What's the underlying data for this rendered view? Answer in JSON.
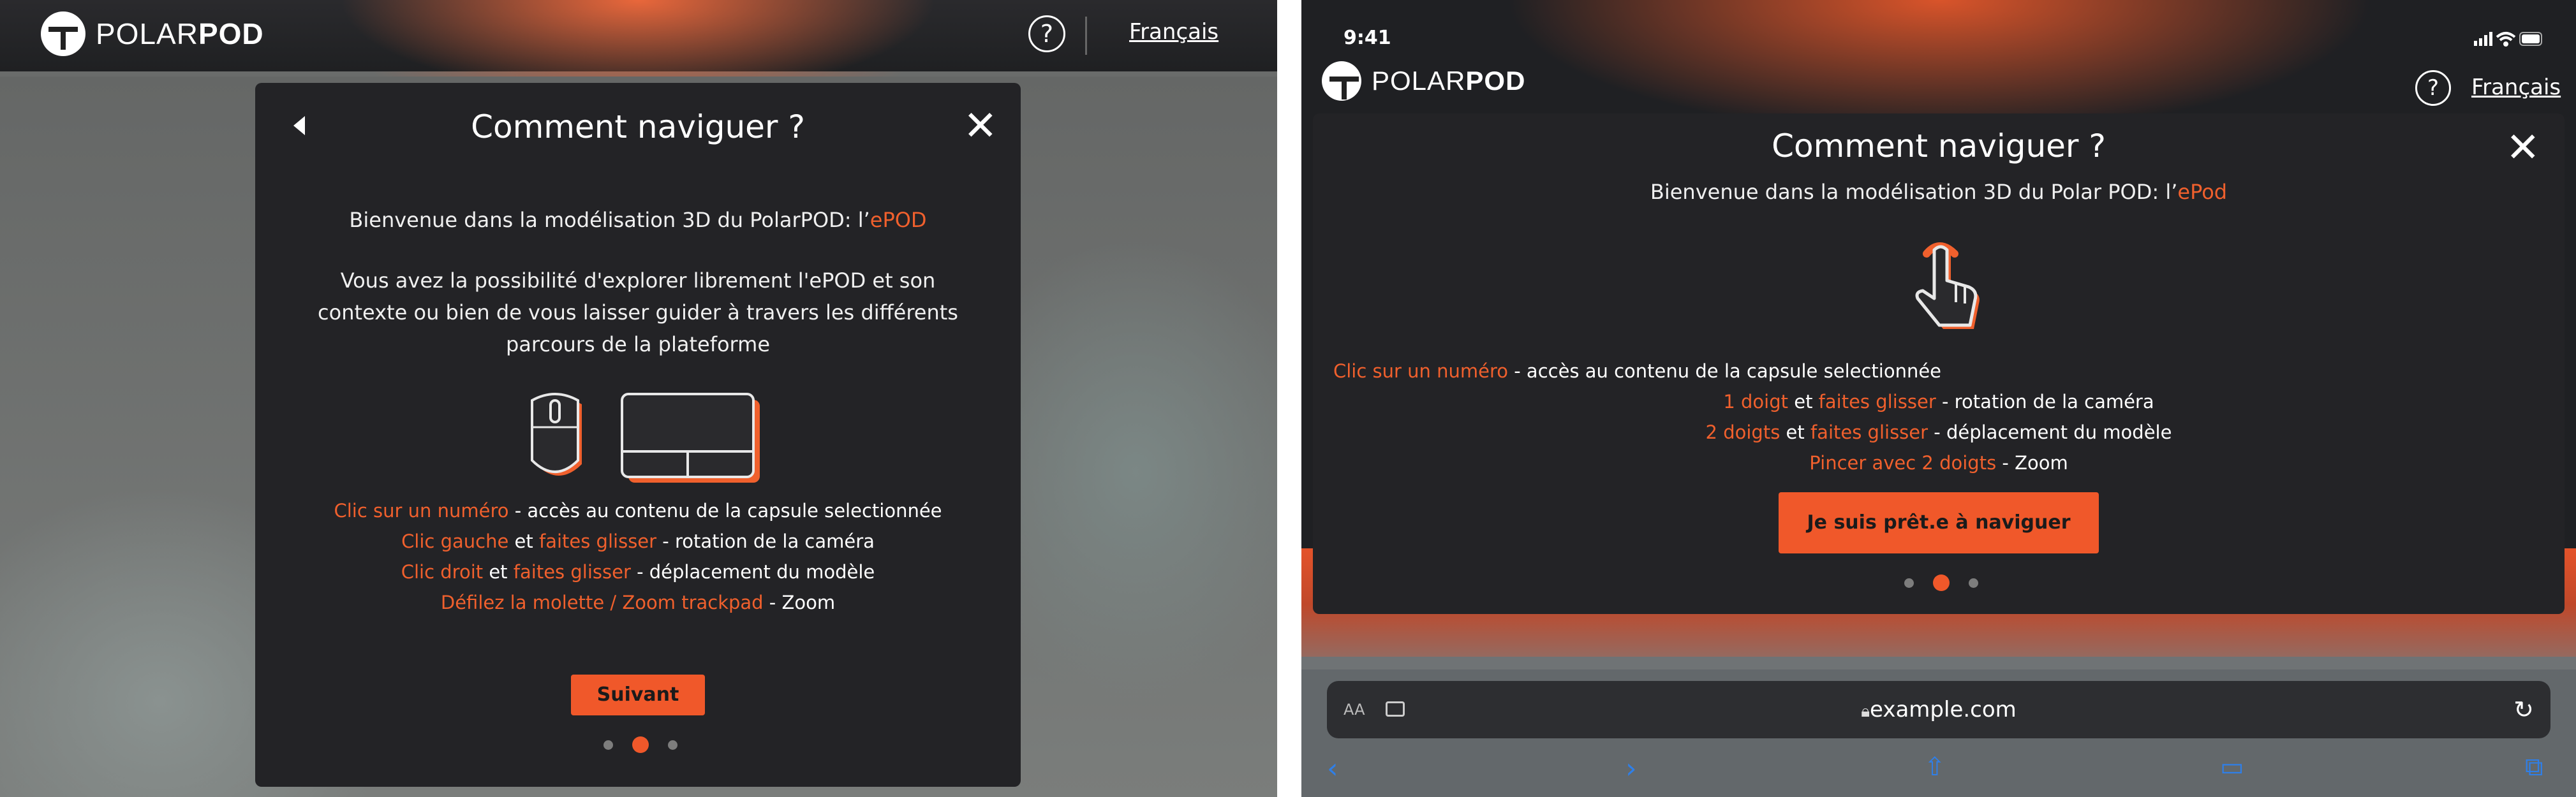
{
  "left": {
    "brand": {
      "light": "POLAR",
      "bold": "POD"
    },
    "help_icon": "question-circle-icon",
    "language": "Français",
    "modal": {
      "title": "Comment naviguer ?",
      "welcome_prefix": "Bienvenue dans la modélisation 3D du PolarPOD: l’",
      "welcome_highlight": "ePOD",
      "intro": "Vous avez la possibilité d'explorer librement l'ePOD et son contexte ou bien de vous laisser guider à travers les différents parcours de la plateforme",
      "illustration": [
        "mouse-icon",
        "trackpad-icon"
      ],
      "instructions": [
        {
          "a": "Clic sur un numéro",
          "b": "",
          "c": "",
          "d": " - accès au contenu de la capsule selectionnée"
        },
        {
          "a": "Clic gauche",
          "b": " et ",
          "c": "faites glisser",
          "d": " - rotation de la caméra"
        },
        {
          "a": "Clic droit",
          "b": " et ",
          "c": "faites glisser",
          "d": " - déplacement du modèle"
        },
        {
          "a": "Défilez la molette / Zoom trackpad",
          "b": "",
          "c": "",
          "d": " - Zoom"
        }
      ],
      "button": "Suivant",
      "pagination": {
        "count": 3,
        "active": 2
      }
    }
  },
  "right": {
    "status_time": "9:41",
    "brand": {
      "light": "POLAR",
      "bold": "POD"
    },
    "language": "Français",
    "modal": {
      "title": "Comment naviguer ?",
      "welcome_prefix": "Bienvenue dans la modélisation 3D du Polar POD: l’",
      "welcome_highlight": "ePod",
      "illustration": "touch-gesture-icon",
      "instructions": [
        {
          "a": "Clic sur un numéro",
          "b": "",
          "c": "",
          "d": " - accès au contenu de la capsule selectionnée"
        },
        {
          "a": "1 doigt",
          "b": " et ",
          "c": "faites glisser",
          "d": " - rotation de la caméra"
        },
        {
          "a": "2 doigts",
          "b": " et ",
          "c": "faites glisser",
          "d": " - déplacement du modèle"
        },
        {
          "a": "Pincer avec 2 doigts",
          "b": "",
          "c": "",
          "d": " - Zoom"
        }
      ],
      "button": "Je suis prêt.e à naviguer",
      "pagination": {
        "count": 3,
        "active": 2
      }
    },
    "browser": {
      "text_size": "AA",
      "url": "example.com",
      "icons": [
        "text-size-icon",
        "extension-icon",
        "lock-icon",
        "reload-icon",
        "back-icon",
        "forward-icon",
        "share-icon",
        "bookmarks-icon",
        "tabs-icon"
      ]
    }
  }
}
